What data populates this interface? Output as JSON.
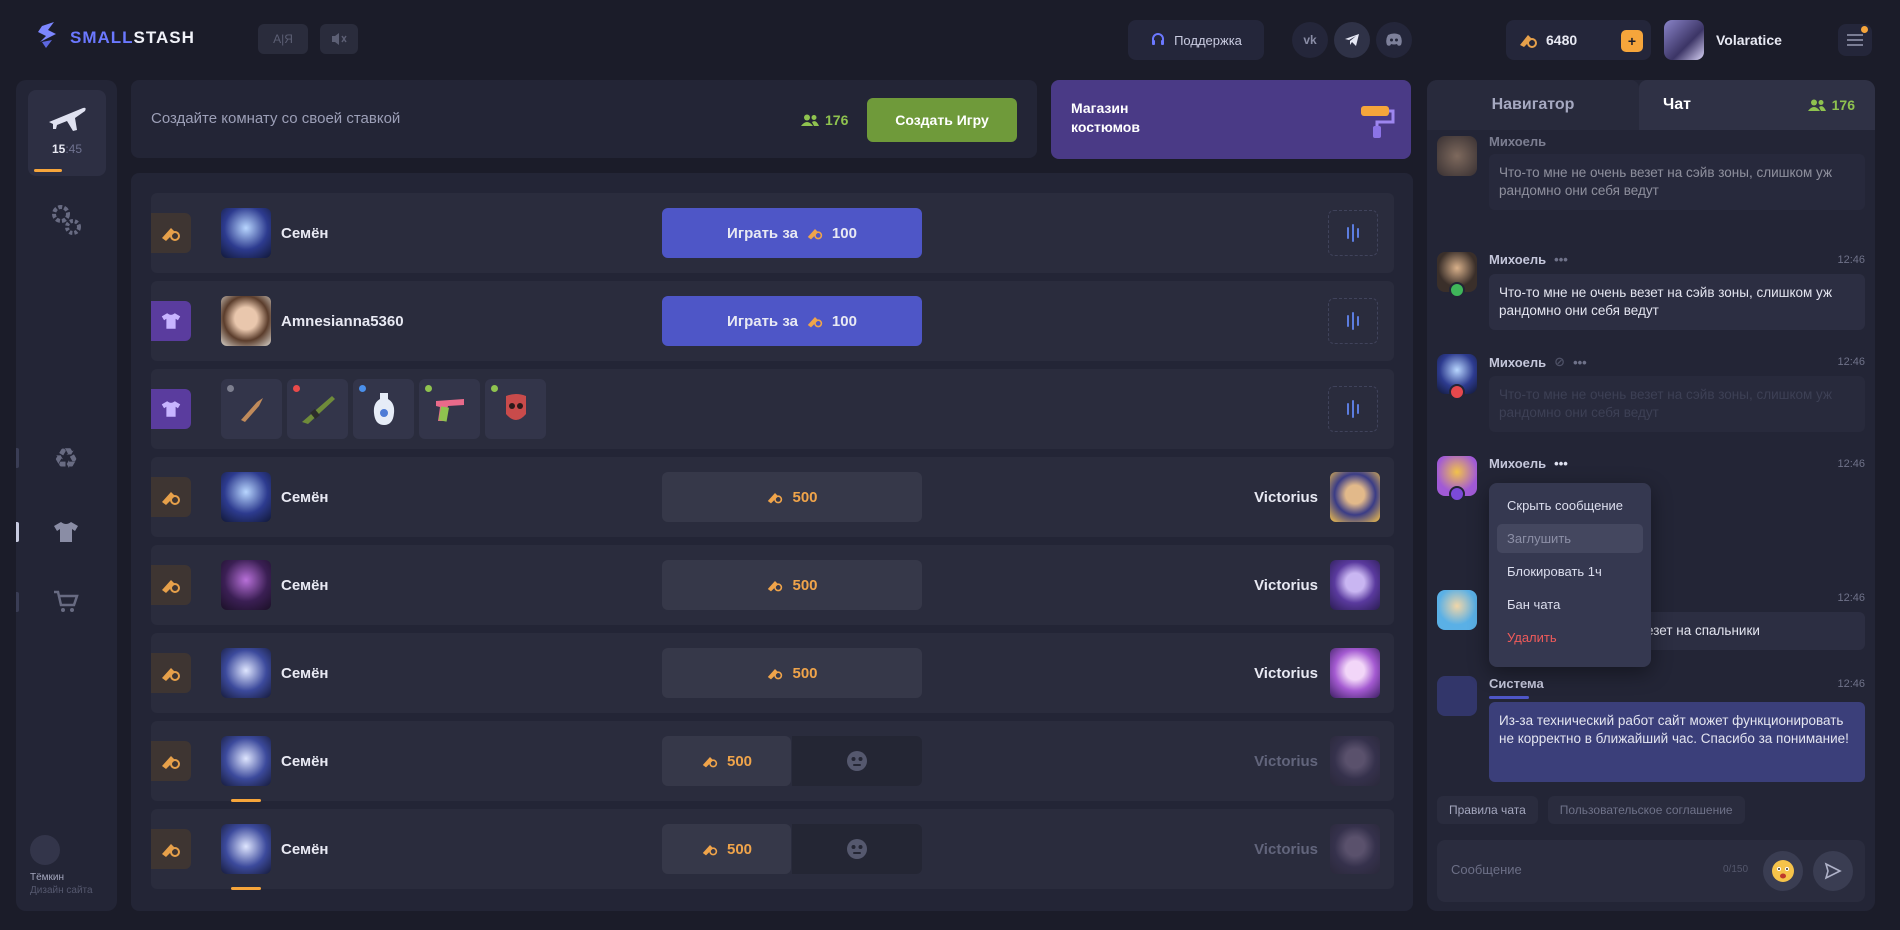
{
  "header": {
    "logo_part1": "SMALL",
    "logo_part2": "STASH",
    "lang_label": "A̸ ̸Я",
    "support_label": "Поддержка",
    "socials": [
      "VK",
      "Telegram",
      "Discord"
    ],
    "balance": "6480",
    "username": "Volaratice"
  },
  "sidebar": {
    "timer": "15",
    "timer_sub": ":45",
    "user_name": "Тёмкин",
    "user_role": "Дизайн сайта",
    "icons": [
      "plane-icon",
      "gears-icon",
      "recycle-icon",
      "tshirt-icon",
      "cart-icon"
    ]
  },
  "create": {
    "placeholder": "Создайте комнату со своей ставкой",
    "online": "176",
    "button": "Создать Игру"
  },
  "shop": {
    "line1": "Магазин",
    "line2": "костюмов"
  },
  "games": [
    {
      "player": "Семён",
      "action": "Играть за",
      "amount": "100",
      "tag": "coin"
    },
    {
      "player": "Amnesianna5360",
      "action": "Играть за",
      "amount": "100",
      "tag": "shirt"
    },
    {
      "tag": "shirt",
      "items": [
        "knife",
        "rifle",
        "vase",
        "pistol",
        "mask"
      ]
    },
    {
      "player": "Семён",
      "amount": "500",
      "opponent": "Victorius",
      "tag": "coin"
    },
    {
      "player": "Семён",
      "amount": "500",
      "opponent": "Victorius",
      "tag": "coin"
    },
    {
      "player": "Семён",
      "amount": "500",
      "opponent": "Victorius",
      "tag": "coin"
    },
    {
      "player": "Семён",
      "amount": "500",
      "opponent": "Victorius",
      "tag": "coin"
    },
    {
      "player": "Семён",
      "amount": "500",
      "opponent": "Victorius",
      "tag": "coin"
    }
  ],
  "chat": {
    "tab_navigator": "Навигатор",
    "tab_chat": "Чат",
    "online": "176",
    "messages": [
      {
        "author": "Михоель",
        "time": "12:46",
        "text": "Что-то мне не очень везет на сэйв зоны, слишком уж рандомно они себя ведут"
      },
      {
        "author": "Михоель",
        "time": "12:46",
        "text": "Что-то мне не очень везет на сэйв зоны, слишком уж рандомно они себя ведут"
      },
      {
        "author": "Михоель",
        "time": "12:46",
        "text": "Что-то мне не очень везет на сэйв зоны, слишком уж рандомно они себя ведут"
      },
      {
        "author": "Михоель",
        "time": "12:46",
        "text": ""
      },
      {
        "author": "",
        "time": "12:46",
        "text": "везет на спальники"
      },
      {
        "author": "Система",
        "time": "12:46",
        "text": "Из-за технический работ сайт может функционировать не корректно в ближайший час. Спасибо за понимание!"
      }
    ],
    "context_menu": [
      "Скрыть сообщение",
      "Заглушить",
      "Блокировать 1ч",
      "Бан чата",
      "Удалить"
    ],
    "links": [
      "Правила чата",
      "Пользовательское соглашение"
    ],
    "input_placeholder": "Сообщение",
    "input_counter": "0/150"
  },
  "colors": {
    "bg": "#1b1c29",
    "panel": "#232536",
    "accent_blue": "#4e56c7",
    "accent_green": "#6f9a3a",
    "accent_orange": "#f6a53b",
    "purple": "#4a3a86",
    "danger": "#f05b5b"
  }
}
